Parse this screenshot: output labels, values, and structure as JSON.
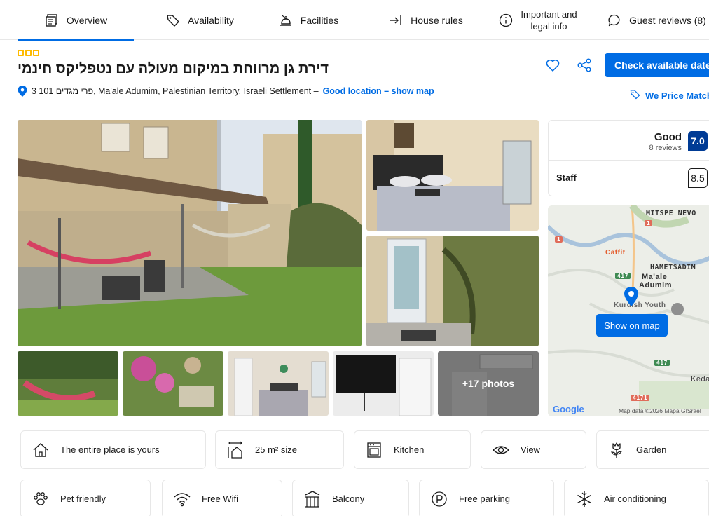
{
  "tabs": [
    {
      "label": "Overview",
      "icon": "overview-icon"
    },
    {
      "label": "Availability",
      "icon": "tag-icon"
    },
    {
      "label": "Facilities",
      "icon": "bell-icon"
    },
    {
      "label": "House rules",
      "icon": "arrow-in-icon"
    },
    {
      "label": "Important and\nlegal info",
      "icon": "info-icon"
    },
    {
      "label": "Guest reviews (8)",
      "icon": "speech-bubble-icon"
    }
  ],
  "property": {
    "title": "דירת גן מרווחת במיקום מעולה עם נטפליקס חינמי",
    "address": "3 101 פרי מגדים, Ma'ale Adumim, Palestinian Territory, Israeli Settlement –",
    "location_link": "Good location – show map"
  },
  "actions": {
    "check_dates": "Check available dates",
    "price_match": "We Price Match"
  },
  "gallery": {
    "more_photos": "+17 photos"
  },
  "review": {
    "word": "Good",
    "count": "8 reviews",
    "score": "7.0",
    "staff_label": "Staff",
    "staff_score": "8.5"
  },
  "map": {
    "labels": {
      "mitspe": "MITSPE NEVO",
      "caffit": "Caffit",
      "hametsadim": "HAMETSADIM",
      "maale1": "Ma'ale",
      "maale2": "Adumim",
      "kurdish": "Kurdish Youth",
      "route_417": "417",
      "route_417b": "417",
      "route_4171": "4171",
      "route_1": "1",
      "route_1b": "1",
      "keda": "Keda"
    },
    "show_on_map": "Show on map",
    "google": "Google",
    "map_data": "Map data ©2026 Mapa GISrael"
  },
  "facilities": [
    {
      "label": "The entire place is yours",
      "icon": "house-icon"
    },
    {
      "label": "25 m² size",
      "icon": "size-icon"
    },
    {
      "label": "Kitchen",
      "icon": "kitchen-icon"
    },
    {
      "label": "View",
      "icon": "eye-icon"
    },
    {
      "label": "Garden",
      "icon": "flower-icon"
    },
    {
      "label": "Pet friendly",
      "icon": "paw-icon"
    },
    {
      "label": "Free Wifi",
      "icon": "wifi-icon"
    },
    {
      "label": "Balcony",
      "icon": "balcony-icon"
    },
    {
      "label": "Free parking",
      "icon": "parking-icon"
    },
    {
      "label": "Air conditioning",
      "icon": "snowflake-icon"
    }
  ],
  "colors": {
    "primary": "#006ce4",
    "score_bg": "#003b95",
    "stars": "#febb02"
  }
}
